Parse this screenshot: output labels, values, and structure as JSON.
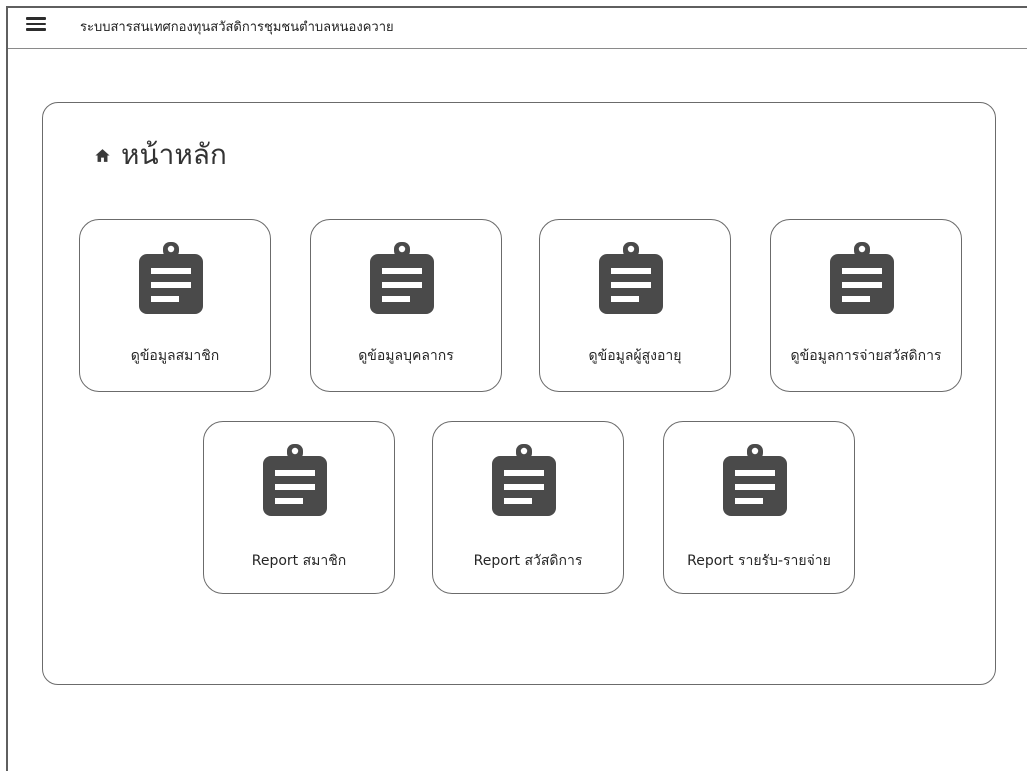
{
  "app": {
    "title": "ระบบสารสนเทศกองทุนสวัสดิการชุมชนตำบลหนองควาย",
    "menu_icon": "hamburger-menu-icon"
  },
  "page": {
    "title": "หน้าหลัก",
    "icon": "home-icon"
  },
  "colors": {
    "icon_fill": "#4a4a4a",
    "border": "#6b6b6b",
    "text": "#333333"
  },
  "menu_cards": [
    {
      "label": "ดูข้อมูลสมาชิก",
      "icon": "clipboard-icon"
    },
    {
      "label": "ดูข้อมูลบุคลากร",
      "icon": "clipboard-icon"
    },
    {
      "label": "ดูข้อมูลผู้สูงอายุ",
      "icon": "clipboard-icon"
    },
    {
      "label": "ดูข้อมูลการจ่ายสวัสดิการ",
      "icon": "clipboard-icon"
    },
    {
      "label": "Report สมาชิก",
      "icon": "clipboard-icon"
    },
    {
      "label": "Report สวัสดิการ",
      "icon": "clipboard-icon"
    },
    {
      "label": "Report รายรับ-รายจ่าย",
      "icon": "clipboard-icon"
    }
  ]
}
